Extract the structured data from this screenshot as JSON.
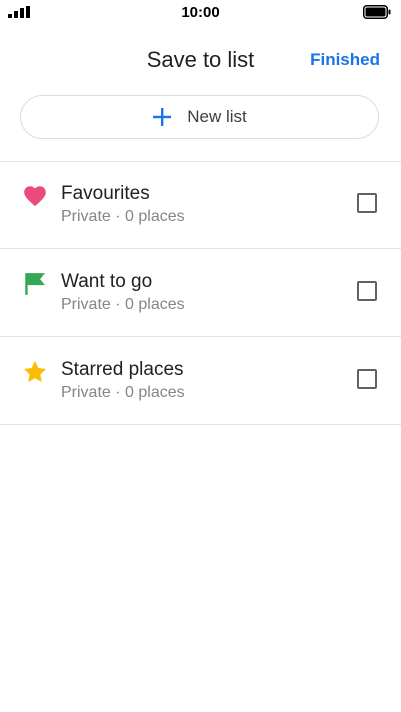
{
  "status_bar": {
    "time": "10:00",
    "signal_icon": "signal-bars-icon",
    "battery_icon": "battery-full-icon"
  },
  "header": {
    "title": "Save to list",
    "finished_label": "Finished"
  },
  "new_list": {
    "label": "New list",
    "icon": "plus-icon",
    "icon_color": "#1a73e8"
  },
  "lists": [
    {
      "name": "Favourites",
      "meta": "Private · 0 places",
      "icon": "heart-icon",
      "icon_color": "#ea4b7a",
      "checked": false
    },
    {
      "name": "Want to go",
      "meta": "Private · 0 places",
      "icon": "flag-icon",
      "icon_color": "#34a853",
      "checked": false
    },
    {
      "name": "Starred places",
      "meta": "Private · 0 places",
      "icon": "star-icon",
      "icon_color": "#fbbc04",
      "checked": false
    }
  ],
  "colors": {
    "accent": "#1a73e8",
    "divider": "#e3e3e3"
  }
}
